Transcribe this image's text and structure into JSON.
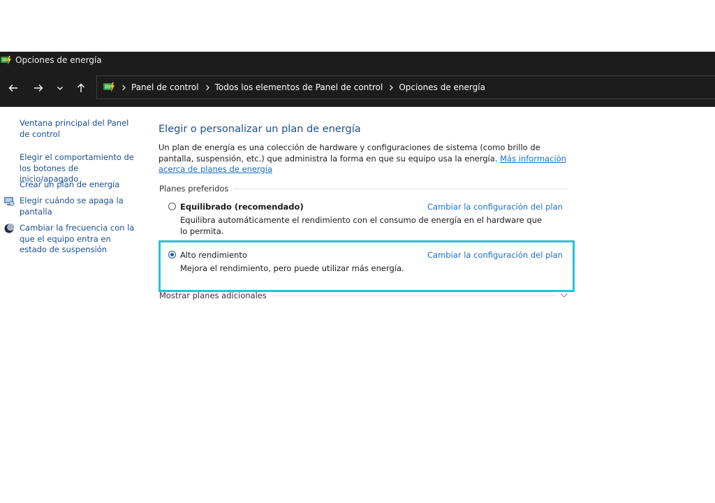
{
  "window": {
    "title": "Opciones de energía"
  },
  "nav": {
    "icons": [
      "arrow-left-icon",
      "arrow-right-icon",
      "chevron-down-icon",
      "arrow-up-icon"
    ]
  },
  "breadcrumb": {
    "items": [
      "Panel de control",
      "Todos los elementos de Panel de control",
      "Opciones de energía"
    ]
  },
  "sidebar": {
    "items": [
      {
        "label": "Ventana principal del Panel de control",
        "icon": null
      },
      {
        "label": "Elegir el comportamiento de los botones de inicio/apagado",
        "icon": null
      },
      {
        "label": "Crear un plan de energía",
        "icon": null
      },
      {
        "label": "Elegir cuándo se apaga la pantalla",
        "icon": "monitor-icon"
      },
      {
        "label": "Cambiar la frecuencia con la que el equipo entra en estado de suspensión",
        "icon": "moon-icon"
      }
    ]
  },
  "main": {
    "heading": "Elegir o personalizar un plan de energía",
    "intro": "Un plan de energía es una colección de hardware y configuraciones de sistema (como brillo de pantalla, suspensión, etc.) que administra la forma en que su equipo usa la energía.",
    "intro_link": "Más información acerca de planes de energía",
    "group_label": "Planes preferidos",
    "plans": [
      {
        "name": "Equilibrado (recomendado)",
        "description": "Equilibra automáticamente el rendimiento con el consumo de energía en el hardware que lo permita.",
        "link": "Cambiar la configuración del plan",
        "selected": false
      },
      {
        "name": "Alto rendimiento",
        "description": "Mejora el rendimiento, pero puede utilizar más energía.",
        "link": "Cambiar la configuración del plan",
        "selected": true
      }
    ],
    "more_plans": "Mostrar planes adicionales"
  },
  "colors": {
    "titlebar_bg": "#1c1c1c",
    "link": "#1a6fc2",
    "heading": "#1a4f8f",
    "highlight": "#22c3dc"
  }
}
